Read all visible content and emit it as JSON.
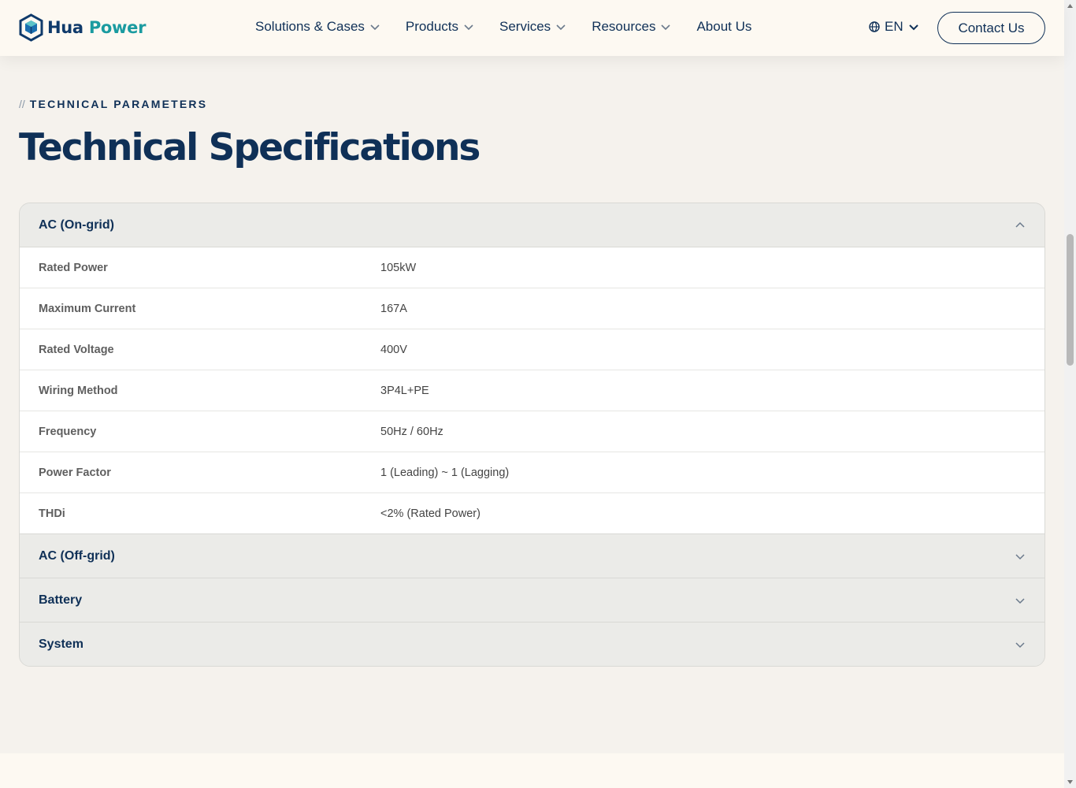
{
  "header": {
    "brand_word1": "Hua",
    "brand_word2": "Power",
    "nav": [
      {
        "label": "Solutions & Cases",
        "has_dropdown": true
      },
      {
        "label": "Products",
        "has_dropdown": true
      },
      {
        "label": "Services",
        "has_dropdown": true
      },
      {
        "label": "Resources",
        "has_dropdown": true
      },
      {
        "label": "About Us",
        "has_dropdown": false
      }
    ],
    "language": "EN",
    "contact_label": "Contact Us"
  },
  "section": {
    "eyebrow_prefix": "//",
    "eyebrow": "TECHNICAL PARAMETERS",
    "title": "Technical Specifications"
  },
  "accordion": {
    "panels": [
      {
        "title": "AC (On-grid)",
        "expanded": true,
        "rows": [
          {
            "label": "Rated Power",
            "value": "105kW"
          },
          {
            "label": "Maximum Current",
            "value": "167A"
          },
          {
            "label": "Rated Voltage",
            "value": "400V"
          },
          {
            "label": "Wiring Method",
            "value": "3P4L+PE"
          },
          {
            "label": "Frequency",
            "value": "50Hz / 60Hz"
          },
          {
            "label": "Power Factor",
            "value": "1 (Leading) ~ 1 (Lagging)"
          },
          {
            "label": "THDi",
            "value": "<2% (Rated Power)"
          }
        ]
      },
      {
        "title": "AC (Off-grid)",
        "expanded": false
      },
      {
        "title": "Battery",
        "expanded": false
      },
      {
        "title": "System",
        "expanded": false
      }
    ]
  },
  "colors": {
    "brand_navy": "#0f3057",
    "brand_teal": "#1a9ba0",
    "page_bg": "#f5f2ed",
    "header_bg": "#fdf9f2"
  },
  "icons": {
    "logo": "hexagon-cube-logo",
    "dropdown": "chevron-down-icon",
    "language": "globe-icon",
    "collapse": "chevron-up-icon"
  }
}
